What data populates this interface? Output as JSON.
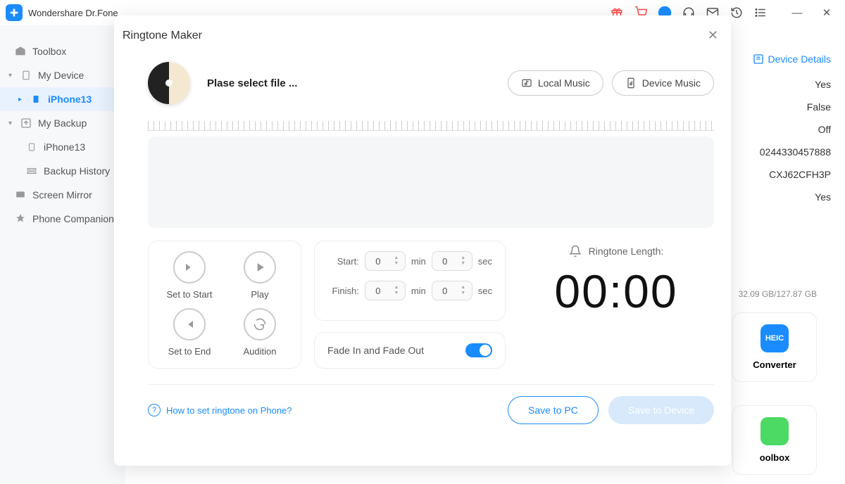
{
  "app": {
    "title": "Wondershare Dr.Fone"
  },
  "sidebar": {
    "items": [
      {
        "label": "Toolbox"
      },
      {
        "label": "My Device"
      },
      {
        "label": "iPhone13"
      },
      {
        "label": "My Backup"
      },
      {
        "label": "iPhone13"
      },
      {
        "label": "Backup History"
      },
      {
        "label": "Screen Mirror"
      },
      {
        "label": "Phone Companion"
      }
    ]
  },
  "bg": {
    "device_details": "Device Details",
    "vals": [
      "Yes",
      "False",
      "Off",
      "0244330457888",
      "CXJ62CFH3P",
      "Yes"
    ],
    "storage": "32.09 GB/127.87 GB",
    "tile1": "Converter",
    "tile2": "oolbox",
    "heic": "HEIC"
  },
  "modal": {
    "title": "Ringtone Maker",
    "select_file": "Plase select file ...",
    "local_music": "Local Music",
    "device_music": "Device Music",
    "set_start": "Set to Start",
    "play": "Play",
    "set_end": "Set to End",
    "audition": "Audition",
    "start_label": "Start:",
    "finish_label": "Finish:",
    "min": "min",
    "sec": "sec",
    "start_min": "0",
    "start_sec": "0",
    "finish_min": "0",
    "finish_sec": "0",
    "fade": "Fade In and Fade Out",
    "ringtone_length": "Ringtone Length:",
    "length_val": "00:00",
    "help": "How to set ringtone on Phone?",
    "save_pc": "Save to PC",
    "save_device": "Save to Device"
  }
}
